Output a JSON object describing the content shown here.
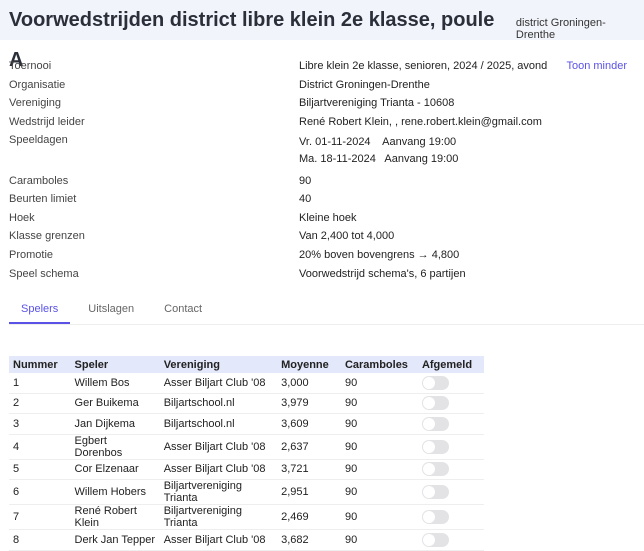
{
  "header": {
    "title": "Voorwedstrijden district libre klein 2e klasse, poule A",
    "subtitle": "district Groningen-Drenthe"
  },
  "info": {
    "toggle_label": "Toon minder",
    "rows": [
      {
        "label": "Toernooi",
        "value": "Libre klein 2e klasse, senioren, 2024 / 2025, avond"
      },
      {
        "label": "Organisatie",
        "value": "District Groningen-Drenthe"
      },
      {
        "label": "Vereniging",
        "value": "Biljartvereniging Trianta - 10608"
      },
      {
        "label": "Wedstrijd leider",
        "value": "René Robert Klein, , rene.robert.klein@gmail.com"
      },
      {
        "label": "Speeldagen",
        "value": "Vr. 01-11-2024    Aanvang 19:00",
        "value2": "Ma. 18-11-2024   Aanvang 19:00"
      },
      {
        "label": "Caramboles",
        "value": "90"
      },
      {
        "label": "Beurten limiet",
        "value": "40"
      },
      {
        "label": "Hoek",
        "value": "Kleine hoek"
      },
      {
        "label": "Klasse grenzen",
        "value": "Van 2,400 tot 4,000"
      },
      {
        "label": "Promotie",
        "value": "20% boven bovengrens → 4,800"
      },
      {
        "label": "Speel schema",
        "value": "Voorwedstrijd schema's, 6 partijen"
      }
    ]
  },
  "tabs": [
    "Spelers",
    "Uitslagen",
    "Contact"
  ],
  "table": {
    "headers": [
      "Nummer",
      "Speler",
      "Vereniging",
      "Moyenne",
      "Caramboles",
      "Afgemeld"
    ],
    "rows": [
      [
        "1",
        "Willem Bos",
        "Asser Biljart Club '08",
        "3,000",
        "90"
      ],
      [
        "2",
        "Ger Buikema",
        "Biljartschool.nl",
        "3,979",
        "90"
      ],
      [
        "3",
        "Jan Dijkema",
        "Biljartschool.nl",
        "3,609",
        "90"
      ],
      [
        "4",
        "Egbert Dorenbos",
        "Asser Biljart Club '08",
        "2,637",
        "90"
      ],
      [
        "5",
        "Cor Elzenaar",
        "Asser Biljart Club '08",
        "3,721",
        "90"
      ],
      [
        "6",
        "Willem Hobers",
        "Biljartvereniging Trianta",
        "2,951",
        "90"
      ],
      [
        "7",
        "René Robert Klein",
        "Biljartvereniging Trianta",
        "2,469",
        "90"
      ],
      [
        "8",
        "Derk Jan Tepper",
        "Asser Biljart Club '08",
        "3,682",
        "90"
      ]
    ]
  }
}
